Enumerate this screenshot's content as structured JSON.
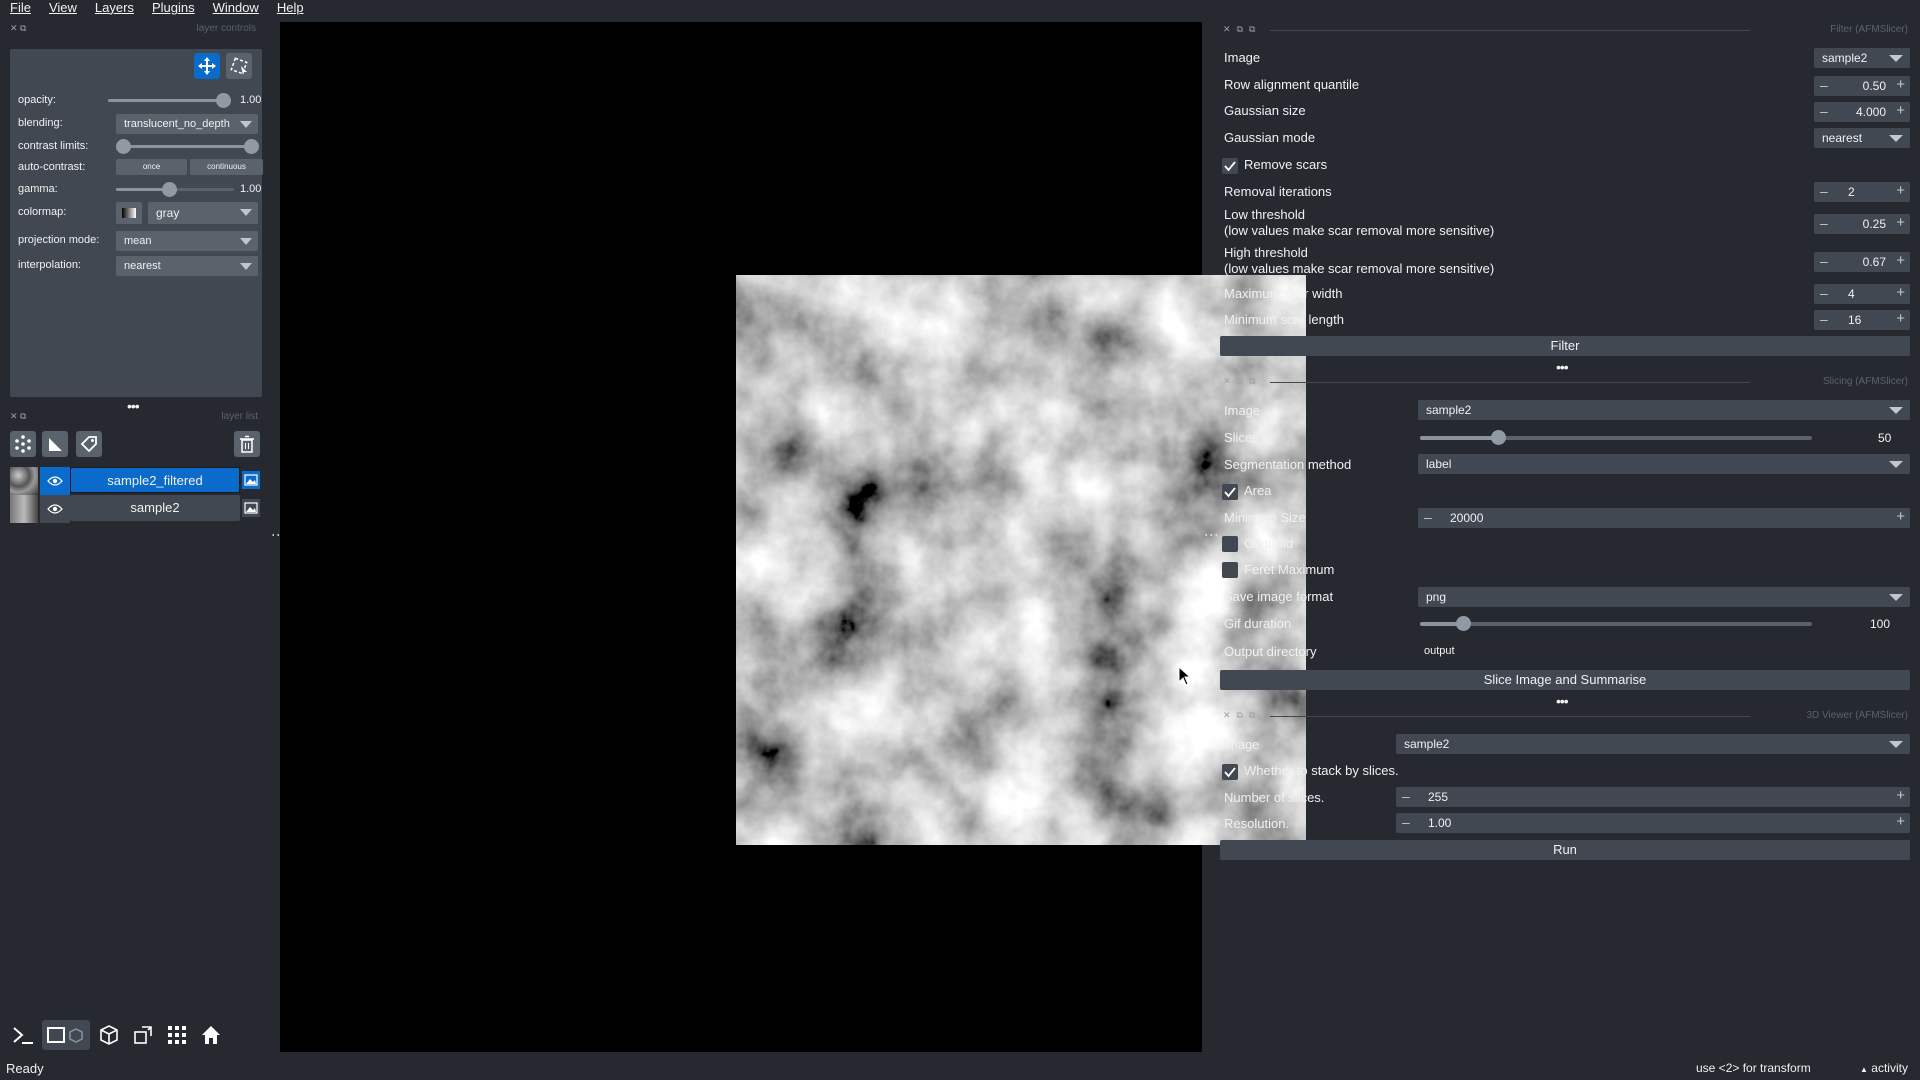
{
  "menubar": {
    "items": [
      "File",
      "View",
      "Layers",
      "Plugins",
      "Window",
      "Help"
    ]
  },
  "layer_controls": {
    "title": "layer controls",
    "opacity": {
      "label": "opacity:",
      "value": "1.00",
      "level": 1.0
    },
    "blending": {
      "label": "blending:",
      "value": "translucent_no_depth"
    },
    "contrast_limits": {
      "label": "contrast limits:",
      "range": [
        0.0,
        1.0
      ]
    },
    "auto_contrast": {
      "label": "auto-contrast:",
      "once": "once",
      "continuous": "continuous"
    },
    "gamma": {
      "label": "gamma:",
      "value": "1.00",
      "level": 0.45
    },
    "colormap": {
      "label": "colormap:",
      "value": "gray"
    },
    "projection_mode": {
      "label": "projection mode:",
      "value": "mean"
    },
    "interpolation": {
      "label": "interpolation:",
      "value": "nearest"
    }
  },
  "layer_list": {
    "title": "layer list",
    "layers": [
      {
        "name": "sample2_filtered",
        "selected": true
      },
      {
        "name": "sample2",
        "selected": false
      }
    ]
  },
  "filter_panel": {
    "title": "Filter (AFMSlicer)",
    "image": {
      "label": "Image",
      "value": "sample2"
    },
    "row_alignment": {
      "label": "Row alignment quantile",
      "value": "0.50"
    },
    "gaussian_size": {
      "label": "Gaussian size",
      "value": "4.000"
    },
    "gaussian_mode": {
      "label": "Gaussian mode",
      "value": "nearest"
    },
    "remove_scars": {
      "label": "Remove scars",
      "checked": true
    },
    "removal_iterations": {
      "label": "Removal iterations",
      "value": "2"
    },
    "low_threshold": {
      "label1": "Low threshold",
      "label2": "(low values make scar removal more sensitive)",
      "value": "0.25"
    },
    "high_threshold": {
      "label1": "High threshold",
      "label2": "(low values make scar removal more sensitive)",
      "value": "0.67"
    },
    "max_scar_width": {
      "label": "Maximum scar width",
      "value": "4"
    },
    "min_scar_length": {
      "label": "Minimum scar length",
      "value": "16"
    },
    "button": "Filter"
  },
  "slicing_panel": {
    "title": "Slicing (AFMSlicer)",
    "image": {
      "label": "Image",
      "value": "sample2"
    },
    "slices": {
      "label": "Slices",
      "value": "50",
      "level": 0.2
    },
    "segmentation": {
      "label": "Segmentation method",
      "value": "label"
    },
    "area": {
      "label": "Area",
      "checked": true
    },
    "min_size": {
      "label": "Minimum Size",
      "value": "20000"
    },
    "centroid": {
      "label": "Centroid",
      "checked": false
    },
    "feret": {
      "label": "Feret Maximum",
      "checked": false
    },
    "save_format": {
      "label": "Save image format",
      "value": "png"
    },
    "gif_duration": {
      "label": "Gif duration",
      "value": "100",
      "level": 0.11
    },
    "output_dir": {
      "label": "Output directory",
      "value": "output"
    },
    "button": "Slice Image and Summarise"
  },
  "viewer3d_panel": {
    "title": "3D Viewer (AFMSlicer)",
    "image": {
      "label": "image",
      "value": "sample2"
    },
    "stack": {
      "label": "Whether to stack by slices.",
      "checked": true
    },
    "num_slices": {
      "label": "Number of slices.",
      "value": "255"
    },
    "resolution": {
      "label": "Resolution.",
      "value": "1.00"
    },
    "button": "Run"
  },
  "status": {
    "text": "Ready",
    "hint": "use <2> for transform",
    "activity": "activity"
  },
  "colors": {
    "bg": "#262930",
    "panel": "#414851",
    "widget": "#5a626c",
    "highlight": "#0a6bcb",
    "text": "#f0f1f2"
  }
}
